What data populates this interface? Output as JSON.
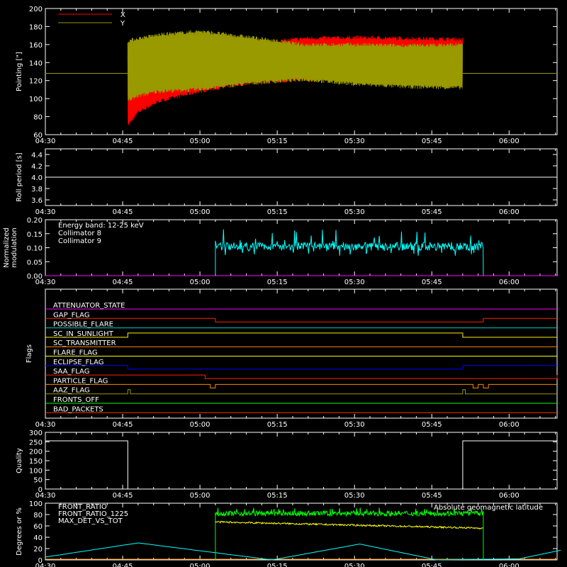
{
  "x_ticks": [
    "04:30",
    "04:45",
    "05:00",
    "05:15",
    "05:30",
    "05:45",
    "06:00"
  ],
  "chart_data": [
    {
      "id": "pointing",
      "type": "line",
      "ylabel": "Pointing [\"]",
      "ylim": [
        60,
        200
      ],
      "y_ticks": [
        60,
        80,
        100,
        120,
        140,
        160,
        180,
        200
      ],
      "legend": [
        {
          "name": "X",
          "color": "#ff0000"
        },
        {
          "name": "Y",
          "color": "#999900"
        }
      ],
      "series": [
        {
          "name": "X",
          "color": "#ff0000",
          "x": [
            "04:46",
            "04:48",
            "04:52",
            "05:00",
            "05:10",
            "05:20",
            "05:30",
            "05:40",
            "05:51"
          ],
          "y_min": [
            70,
            85,
            97,
            108,
            118,
            121,
            122,
            121,
            122
          ],
          "y_max": [
            150,
            152,
            155,
            158,
            160,
            167,
            168,
            167,
            166
          ]
        },
        {
          "name": "Y",
          "color": "#999900",
          "x": [
            "04:46",
            "04:48",
            "04:52",
            "05:00",
            "05:10",
            "05:20",
            "05:30",
            "05:40",
            "05:51"
          ],
          "y_min": [
            97,
            103,
            108,
            110,
            117,
            121,
            116,
            113,
            112
          ],
          "y_max": [
            164,
            167,
            171,
            175,
            168,
            160,
            160,
            159,
            160
          ],
          "baseline": 128
        }
      ]
    },
    {
      "id": "roll",
      "type": "line",
      "ylabel": "Roll period [s]",
      "ylim": [
        3.5,
        4.5
      ],
      "y_ticks": [
        "3.6",
        "3.8",
        "4.0",
        "4.2",
        "4.4"
      ],
      "series": [
        {
          "name": "",
          "color": "#ffffff",
          "value": 4.0
        }
      ]
    },
    {
      "id": "modulation",
      "type": "line",
      "ylabel": [
        "Normalized",
        "modulation"
      ],
      "ylim": [
        0,
        0.2
      ],
      "y_ticks": [
        "0.00",
        "0.05",
        "0.10",
        "0.15",
        "0.20"
      ],
      "legend": [
        {
          "name": "Energy band: 12-25 keV",
          "color": "#ffffff"
        },
        {
          "name": "Collimator 8",
          "color": "#00ffff"
        },
        {
          "name": "Collimator 9",
          "color": "#ff00ff"
        }
      ],
      "series": [
        {
          "name": "Collimator 8",
          "color": "#00ffff",
          "start": "05:03",
          "end": "05:55",
          "mean": 0.105,
          "min": 0.07,
          "max": 0.17
        },
        {
          "name": "Collimator 9",
          "color": "#ff00ff",
          "value": 0.0
        }
      ]
    },
    {
      "id": "flags",
      "type": "line",
      "ylabel": "Flags",
      "flags": [
        {
          "name": "ATTENUATOR_STATE",
          "color": "#ff00ff",
          "steps": []
        },
        {
          "name": "GAP_FLAG",
          "color": "#ff2200",
          "steps": [
            [
              "05:03",
              "05:55",
              "low"
            ]
          ]
        },
        {
          "name": "POSSIBLE_FLARE",
          "color": "#00cccc",
          "steps": []
        },
        {
          "name": "SC_IN_SUNLIGHT",
          "color": "#ffee00",
          "steps": [
            [
              "04:46",
              "05:51",
              "high"
            ]
          ]
        },
        {
          "name": "SC_TRANSMITTER",
          "color": "#ff8800",
          "steps": []
        },
        {
          "name": "FLARE_FLAG",
          "color": "#ffff00",
          "steps": []
        },
        {
          "name": "ECLIPSE_FLAG",
          "color": "#0000ff",
          "steps": [
            [
              "04:46",
              "05:51",
              "low"
            ]
          ]
        },
        {
          "name": "SAA_FLAG",
          "color": "#ff2200",
          "steps": [
            [
              "05:01",
              "06:10",
              "low"
            ]
          ]
        },
        {
          "name": "PARTICLE_FLAG",
          "color": "#ff8800",
          "steps": [
            [
              "05:02",
              "05:03",
              "low"
            ],
            [
              "05:53",
              "05:54",
              "low"
            ],
            [
              "05:55",
              "05:56",
              "low"
            ]
          ]
        },
        {
          "name": "AAZ_FLAG",
          "color": "#999900",
          "steps": [
            [
              "04:46",
              "04:46.5",
              "high"
            ],
            [
              "05:51",
              "05:51.5",
              "high"
            ]
          ]
        },
        {
          "name": "FRONTS_OFF",
          "color": "#00ff00",
          "steps": []
        },
        {
          "name": "BAD_PACKETS",
          "color": "#ff3300",
          "steps": []
        }
      ]
    },
    {
      "id": "quality",
      "type": "line",
      "ylabel": "Quality",
      "ylim": [
        0,
        300
      ],
      "y_ticks": [
        0,
        50,
        100,
        150,
        200,
        250,
        300
      ],
      "series": [
        {
          "name": "",
          "color": "#ffffff",
          "segments": [
            {
              "x": [
                "04:30",
                "04:46"
              ],
              "y": 255
            },
            {
              "x": [
                "04:46",
                "05:51"
              ],
              "y": 0
            },
            {
              "x": [
                "05:51",
                "06:10"
              ],
              "y": 255
            }
          ]
        }
      ]
    },
    {
      "id": "ratios",
      "type": "line",
      "ylabel": "Degrees or %",
      "ylim": [
        0,
        100
      ],
      "y_ticks": [
        0,
        20,
        40,
        60,
        80,
        100
      ],
      "legend": [
        {
          "name": "FRONT_RATIO",
          "color": "#ffff00"
        },
        {
          "name": "FRONT_RATIO_1225",
          "color": "#00ff00"
        },
        {
          "name": "MAX_DET_VS_TOT",
          "color": "#ff8800"
        },
        {
          "name": "Absolute geomagnetic latitude",
          "color": "#00ffff"
        }
      ],
      "series": [
        {
          "name": "FRONT_RATIO",
          "color": "#ffff00",
          "start": "05:03",
          "end": "05:55",
          "start_value": 67,
          "end_value": 56
        },
        {
          "name": "FRONT_RATIO_1225",
          "color": "#00ff00",
          "start": "05:03",
          "end": "05:55",
          "mean": 82,
          "min": 75,
          "max": 92
        },
        {
          "name": "MAX_DET_VS_TOT",
          "color": "#ff8800",
          "value": 0
        },
        {
          "name": "Absolute geomagnetic latitude",
          "color": "#00ffff",
          "x": [
            "04:30",
            "04:48",
            "05:14",
            "05:31",
            "05:46",
            "06:02",
            "06:10"
          ],
          "y": [
            5,
            30,
            0,
            28,
            0,
            2,
            17
          ]
        }
      ]
    }
  ]
}
